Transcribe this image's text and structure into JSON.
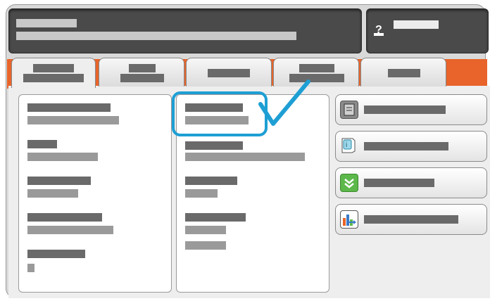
{
  "header": {
    "status_text": "",
    "login_icon": "question-key-icon"
  },
  "tabs": [
    {
      "label": "",
      "active": true
    },
    {
      "label": "",
      "active": false
    },
    {
      "label": "",
      "active": false
    },
    {
      "label": "",
      "active": false
    },
    {
      "label": "",
      "active": false
    }
  ],
  "columns": {
    "left": {
      "items": [
        "",
        "",
        "",
        "",
        ""
      ]
    },
    "middle": {
      "items": [
        "",
        "",
        "",
        ""
      ],
      "selected_index": 0
    }
  },
  "side_buttons": [
    {
      "label": "",
      "icon": "document-list-icon"
    },
    {
      "label": "",
      "icon": "info-page-icon"
    },
    {
      "label": "",
      "icon": "double-chevron-down-icon"
    },
    {
      "label": "",
      "icon": "bar-chart-icon"
    }
  ],
  "colors": {
    "accent_orange": "#e8642a",
    "highlight_blue": "#1e9fd4",
    "panel_gray": "#eeeeee",
    "header_dark": "#4a4a4a"
  }
}
